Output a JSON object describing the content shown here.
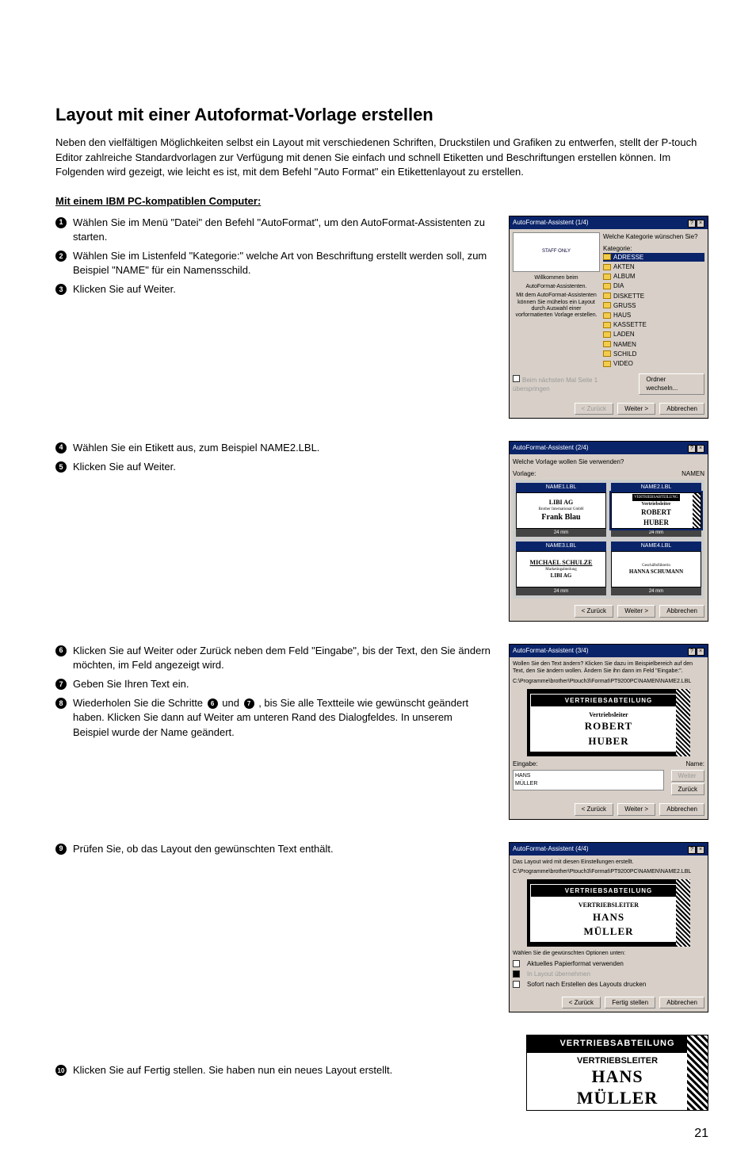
{
  "page": {
    "title": "Layout mit einer Autoformat-Vorlage erstellen",
    "intro": "Neben den vielfältigen Möglichkeiten selbst ein Layout mit verschiedenen Schriften, Druckstilen und Grafiken zu entwerfen, stellt der P-touch Editor zahlreiche Standardvorlagen zur Verfügung mit denen Sie einfach und schnell Etiketten und Beschriftungen erstellen können. Im Folgenden wird gezeigt, wie leicht es ist, mit dem Befehl \"Auto Format\" ein Etikettenlayout zu erstellen.",
    "subhead": "Mit einem IBM PC-kompatiblen Computer:",
    "pageNumber": "21"
  },
  "steps": {
    "s1": "Wählen Sie im Menü \"Datei\" den Befehl \"AutoFormat\", um den AutoFormat-Assistenten zu starten.",
    "s2": "Wählen Sie im Listenfeld \"Kategorie:\" welche Art von Beschriftung erstellt werden soll, zum Beispiel  \"NAME\" für ein Namensschild.",
    "s3": "Klicken Sie auf Weiter.",
    "s4": "Wählen Sie ein Etikett aus, zum Beispiel NAME2.LBL.",
    "s5": "Klicken Sie auf Weiter.",
    "s6": "Klicken Sie auf Weiter oder Zurück neben dem Feld \"Eingabe\", bis der Text, den Sie ändern möchten, im Feld angezeigt wird.",
    "s7": "Geben Sie Ihren Text ein.",
    "s8a": "Wiederholen Sie die Schritte ",
    "s8b": " und ",
    "s8c": " , bis Sie alle Textteile wie gewünscht geändert haben. Klicken Sie dann auf Weiter am unteren Rand des Dialogfeldes. In unserem Beispiel wurde der Name geändert.",
    "s9": "Prüfen Sie, ob das Layout den gewünschten Text enthält.",
    "s10": "Klicken Sie auf Fertig stellen. Sie haben nun ein neues Layout erstellt."
  },
  "dlg1": {
    "title": "AutoFormat-Assistent (1/4)",
    "question": "Welche Kategorie wünschen Sie?",
    "catLabel": "Kategorie:",
    "welcome1": "Willkommen beim",
    "welcome2": "AutoFormat-Assistenten.",
    "welcome3": "Mit dem AutoFormat-Assistenten können Sie mühelos ein Layout durch Auswahl einer vorformatierten Vorlage erstellen.",
    "logo": "STAFF ONLY",
    "cats": [
      "ADRESSE",
      "AKTEN",
      "ALBUM",
      "DIA",
      "DISKETTE",
      "GRUSS",
      "HAUS",
      "KASSETTE",
      "LADEN",
      "NAMEN",
      "SCHILD",
      "VIDEO"
    ],
    "chkText": "Beim nächsten Mal Seite 1 überspringen",
    "btnChange": "Ordner wechseln...",
    "btnBack": "< Zurück",
    "btnNext": "Weiter >",
    "btnCancel": "Abbrechen"
  },
  "dlg2": {
    "title": "AutoFormat-Assistent (2/4)",
    "question": "Welche Vorlage wollen Sie verwenden?",
    "vorlage": "Vorlage:",
    "category": "NAMEN",
    "tpl1Label": "NAME1.LBL",
    "tpl1Line1": "LIBI AG",
    "tpl1Line2": "Brother International GmbH",
    "tpl1Line3": "Frank Blau",
    "tpl2Label": "NAME2.LBL",
    "tpl2Line1": "VERTRIEBSABTEILUNG",
    "tpl2Line2": "Vertriebsleiter",
    "tpl2Line3": "ROBERT",
    "tpl2Line4": "HUBER",
    "tpl3Label": "NAME3.LBL",
    "tpl3Line1": "MICHAEL SCHULZE",
    "tpl3Line2": "Marketingabteilung",
    "tpl3Line3": "LIBI AG",
    "tpl4Label": "NAME4.LBL",
    "tpl4Line1": "Geschäftsführerin",
    "tpl4Line2": "HANNA SCHUMANN",
    "size": "24 mm",
    "btnBack": "< Zurück",
    "btnNext": "Weiter >",
    "btnCancel": "Abbrechen"
  },
  "dlg3": {
    "title": "AutoFormat-Assistent (3/4)",
    "instructions": "Wollen Sie den Text ändern? Klicken Sie dazu im Beispielbereich auf den Text, den Sie ändern wollen. Ändern Sie ihn dann im Feld \"Eingabe:\".",
    "path": "C:\\Programme\\brother\\Ptouch3\\Format\\PT9200PC\\NAMEN\\NAME2.LBL",
    "pvDept": "VERTRIEBSABTEILUNG",
    "pvRole": "Vertriebsleiter",
    "pvName1": "ROBERT",
    "pvName2": "HUBER",
    "eingabeLabel": "Eingabe:",
    "nameLabel": "Name:",
    "eingabeValue": "HANS\nMÜLLER",
    "btnWeiterField": "Weiter",
    "btnZurueckField": "Zurück",
    "btnBack": "< Zurück",
    "btnNext": "Weiter >",
    "btnCancel": "Abbrechen"
  },
  "dlg4": {
    "title": "AutoFormat-Assistent (4/4)",
    "msg": "Das Layout wird mit diesen Einstellungen erstellt.",
    "path": "C:\\Programme\\brother\\Ptouch3\\Format\\PT9200PC\\NAMEN\\NAME2.LBL",
    "pvDept": "VERTRIEBSABTEILUNG",
    "pvRole": "VERTRIEBSLEITER",
    "pvName1": "HANS",
    "pvName2": "MÜLLER",
    "optHeader": "Wählen Sie die gewünschten Optionen unten:",
    "opt1": "Aktuelles Papierformat verwenden",
    "opt2": "In Layout übernehmen",
    "opt3": "Sofort nach Erstellen des Layouts drucken",
    "btnBack": "< Zurück",
    "btnFinish": "Fertig stellen",
    "btnCancel": "Abbrechen"
  },
  "finalLabel": {
    "dept": "VERTRIEBSABTEILUNG",
    "role": "VERTRIEBSLEITER",
    "name1": "HANS",
    "name2": "MÜLLER"
  }
}
